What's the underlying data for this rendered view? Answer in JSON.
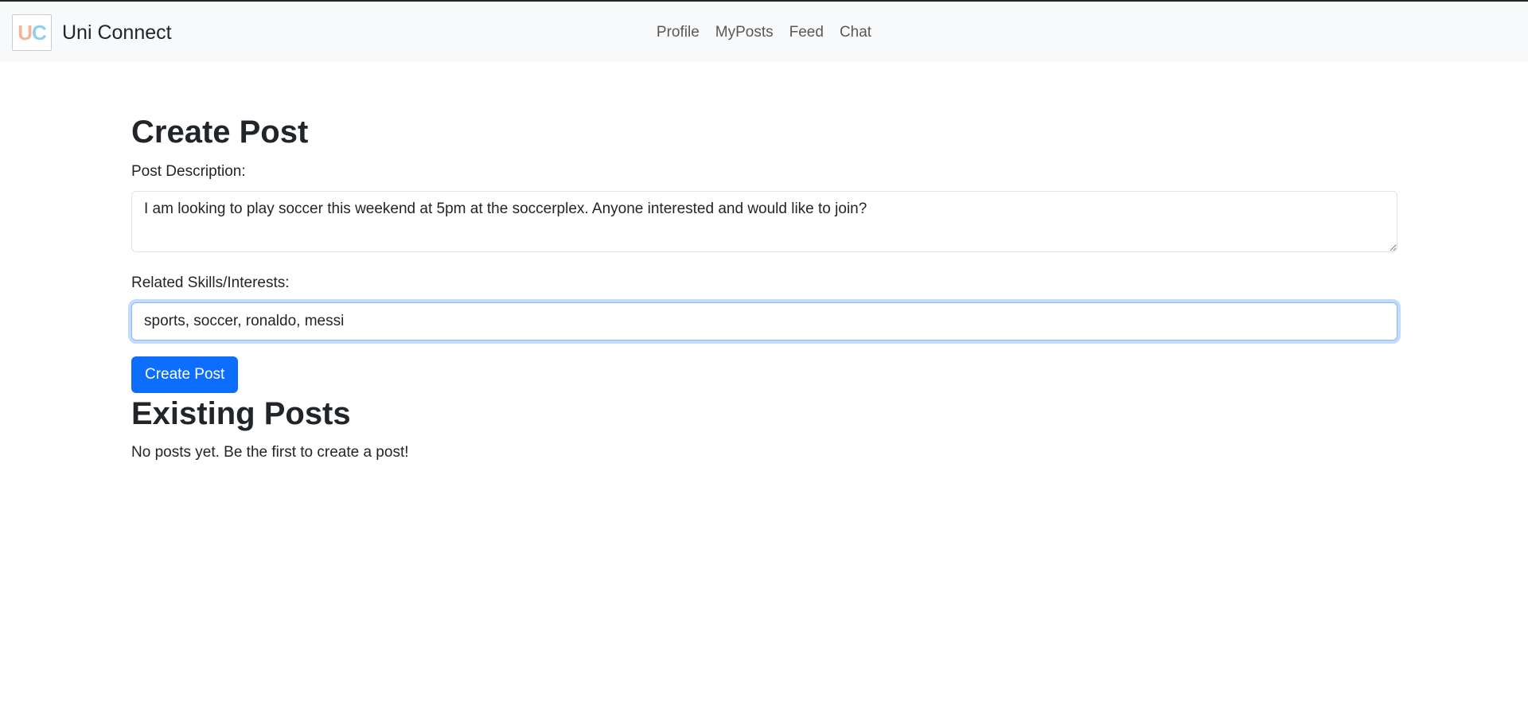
{
  "navbar": {
    "logo_text_u": "U",
    "logo_text_c": "C",
    "brand_name": "Uni Connect",
    "links": [
      "Profile",
      "MyPosts",
      "Feed",
      "Chat"
    ]
  },
  "create_post": {
    "title": "Create Post",
    "description_label": "Post Description:",
    "description_value": "I am looking to play soccer this weekend at 5pm at the soccerplex. Anyone interested and would like to join?",
    "skills_label": "Related Skills/Interests:",
    "skills_value": "sports, soccer, ronaldo, messi",
    "submit_label": "Create Post"
  },
  "existing_posts": {
    "title": "Existing Posts",
    "empty_message": "No posts yet. Be the first to create a post!"
  },
  "colors": {
    "primary": "#0d6efd",
    "navbar_bg": "#f8f9fa",
    "text": "#212529"
  }
}
